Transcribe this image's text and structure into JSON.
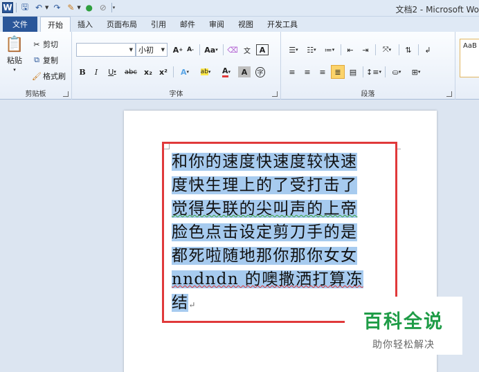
{
  "window": {
    "title": "文档2 - Microsoft Wo"
  },
  "qat": {
    "icons": [
      "word-icon",
      "save-icon",
      "undo-icon",
      "redo-icon",
      "format-painter-icon",
      "circle-icon",
      "no-entry-icon"
    ]
  },
  "tabs": [
    {
      "label": "文件",
      "kind": "file"
    },
    {
      "label": "开始",
      "kind": "active"
    },
    {
      "label": "插入"
    },
    {
      "label": "页面布局"
    },
    {
      "label": "引用"
    },
    {
      "label": "邮件"
    },
    {
      "label": "审阅"
    },
    {
      "label": "视图"
    },
    {
      "label": "开发工具"
    }
  ],
  "clipboard": {
    "label": "剪贴板",
    "paste": "粘贴",
    "cut": "剪切",
    "copy": "复制",
    "format_painter": "格式刷"
  },
  "font": {
    "label": "字体",
    "font_name_value": "",
    "font_size_value": "小初",
    "grow": "A",
    "shrink": "A",
    "case": "Aa",
    "bold": "B",
    "italic": "I",
    "underline": "U",
    "strike": "abc",
    "subscript": "x₂",
    "superscript": "x²",
    "text_effect": "A",
    "highlight": "ab",
    "font_color": "A",
    "char_shading": "A",
    "enclose": "字"
  },
  "paragraph": {
    "label": "段落"
  },
  "styles": {
    "preview": "AaB"
  },
  "document": {
    "lines": [
      "和你的速度快速度较快速",
      "度快生理上的了受打击了",
      "觉得失联的尖叫声的上帝",
      "脸色点击设定剪刀手的是",
      "都死啦随地那你那你女女",
      "nndndn  的噢撒洒打算冻",
      "结"
    ],
    "paragraph_mark": "↵"
  },
  "watermark": {
    "title": "百科全说",
    "subtitle": "助你轻松解决"
  },
  "colors": {
    "file_tab": "#2a5699",
    "selection": "#a7cbef",
    "red_frame": "#e0393a",
    "watermark_green": "#1f9c47"
  }
}
